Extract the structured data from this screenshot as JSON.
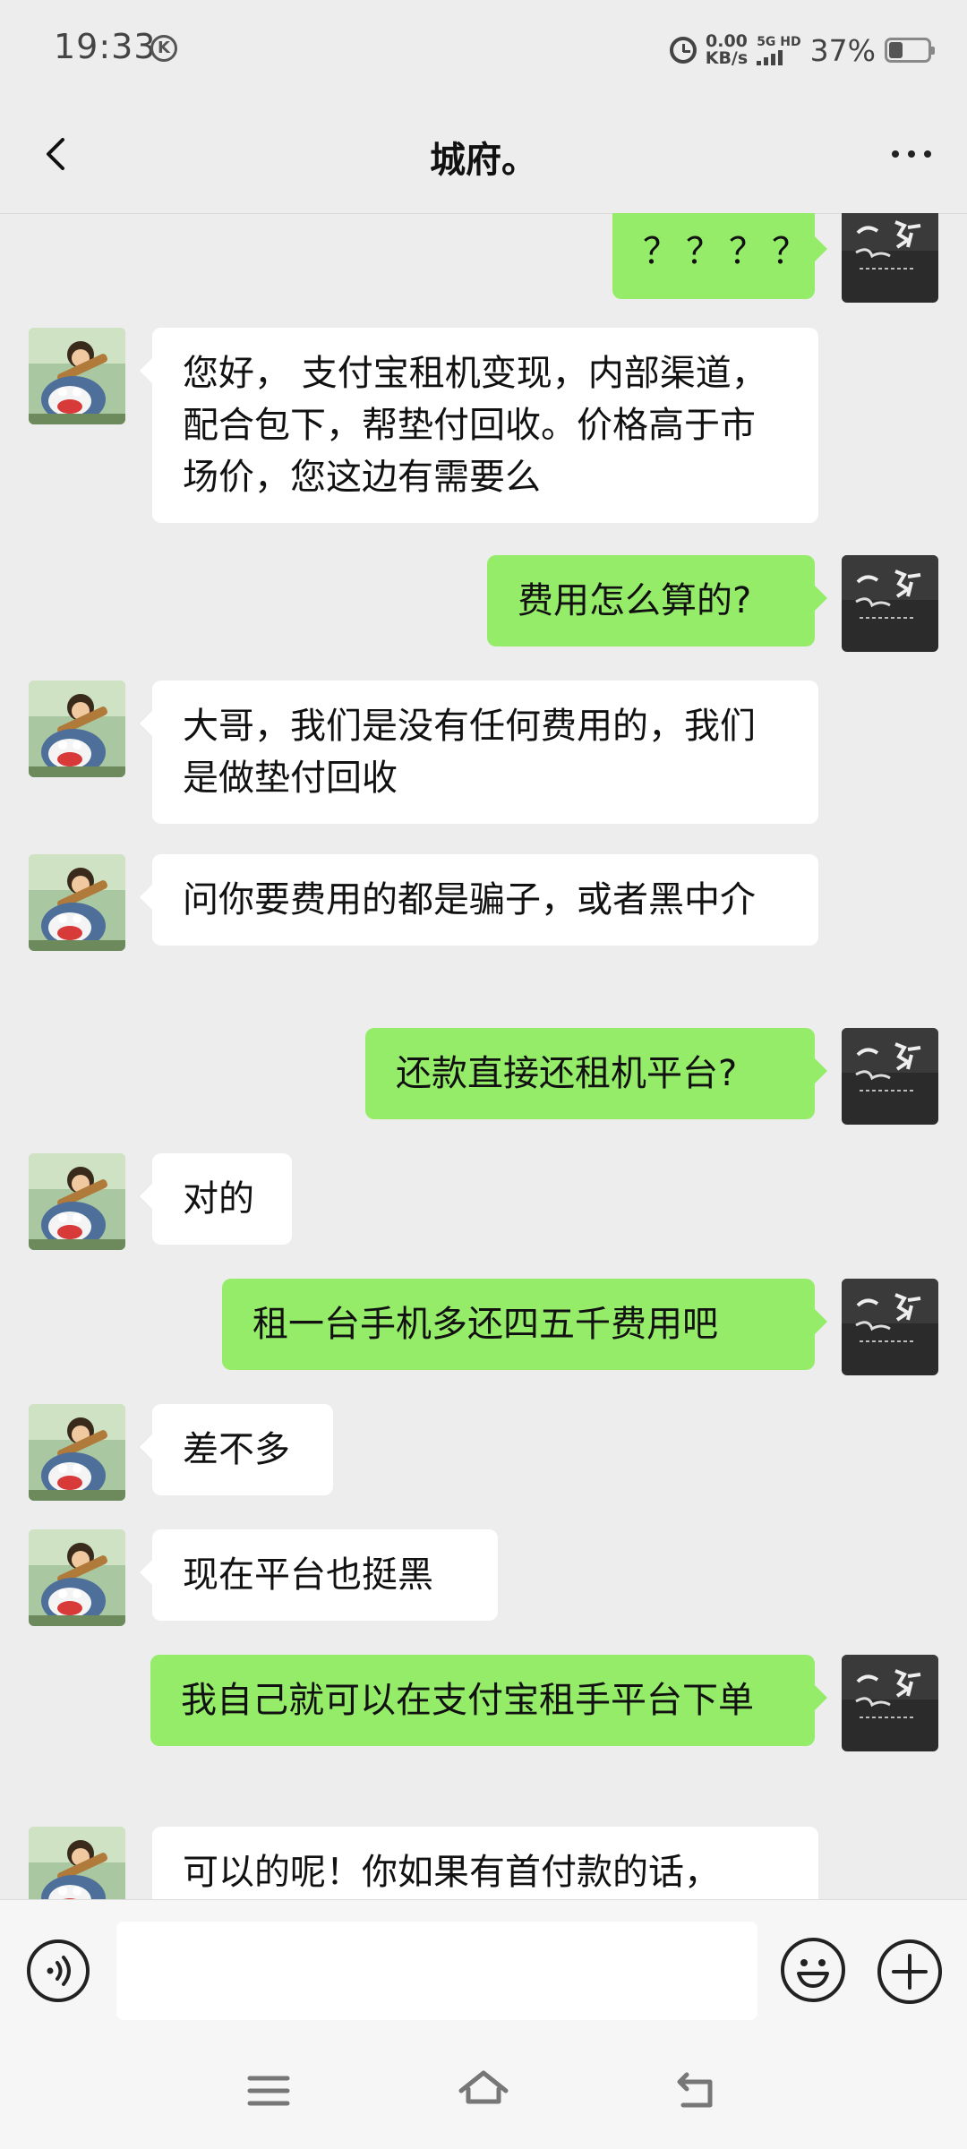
{
  "status_bar": {
    "time": "19:33",
    "k_badge": "K",
    "net_speed_value": "0.00",
    "net_speed_unit": "KB/s",
    "network_label": "5G HD",
    "battery_percent": "37%",
    "battery_level": 0.37
  },
  "header": {
    "title": "城府。"
  },
  "messages": [
    {
      "side": "out",
      "text": "？？？？"
    },
    {
      "side": "in",
      "text": "您好， 支付宝租机变现，内部渠道，配合包下，帮垫付回收。价格高于市场价，您这边有需要么"
    },
    {
      "side": "out",
      "text": "费用怎么算的?"
    },
    {
      "side": "in",
      "text": "大哥，我们是没有任何费用的，我们是做垫付回收"
    },
    {
      "side": "in",
      "text": "问你要费用的都是骗子，或者黑中介"
    },
    {
      "side": "out",
      "text": "还款直接还租机平台?"
    },
    {
      "side": "in",
      "text": "对的"
    },
    {
      "side": "out",
      "text": "租一台手机多还四五千费用吧"
    },
    {
      "side": "in",
      "text": "差不多"
    },
    {
      "side": "in",
      "text": "现在平台也挺黑"
    },
    {
      "side": "out",
      "text": "我自己就可以在支付宝租手平台下单"
    },
    {
      "side": "in",
      "text": "可以的呢！你如果有首付款的话，"
    }
  ],
  "colors": {
    "background": "#ededed",
    "outgoing_bubble": "#95ec69",
    "incoming_bubble": "#ffffff"
  },
  "icons": {
    "back": "chevron-left-icon",
    "more": "more-dots-icon",
    "voice": "voice-icon",
    "emoji": "emoji-icon",
    "plus": "plus-icon",
    "nav_menu": "menu-icon",
    "nav_home": "home-icon",
    "nav_back": "nav-back-icon"
  }
}
